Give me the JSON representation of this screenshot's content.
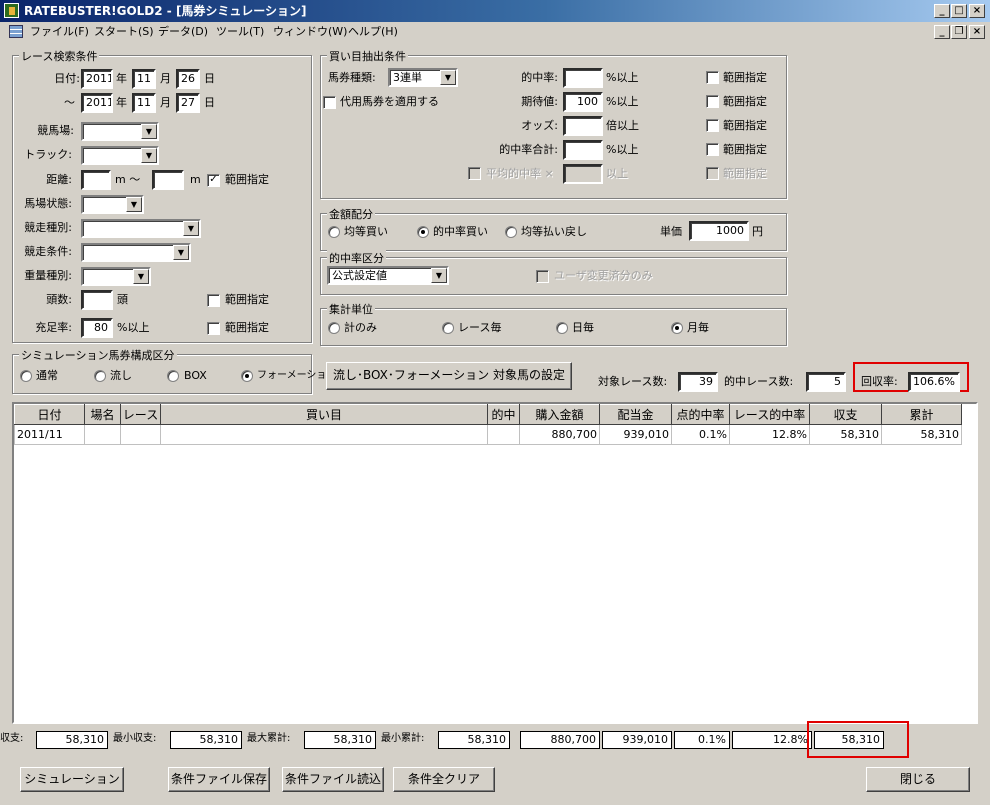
{
  "window": {
    "title": "RATEBUSTER!GOLD2 - [馬券シミュレーション]"
  },
  "menu": [
    "ファイル(F)",
    "スタート(S)",
    "データ(D)",
    "ツール(T)",
    "ウィンドウ(W)",
    "ヘルプ(H)"
  ],
  "race": {
    "caption": "レース検索条件",
    "date_label": "日付:",
    "tilde": "～",
    "from": {
      "year": "2011",
      "month": "11",
      "day": "26"
    },
    "to": {
      "year": "2011",
      "month": "11",
      "day": "27"
    },
    "year_unit": "年",
    "month_unit": "月",
    "day_unit": "日",
    "course_label": "競馬場:",
    "track_label": "トラック:",
    "distance_label": "距離:",
    "m_unit": "m",
    "m_tilde": "m ～",
    "range_label": "範囲指定",
    "condition_label": "馬場状態:",
    "type_label": "競走種別:",
    "cond_label": "競走条件:",
    "weight_label": "重量種別:",
    "heads_label": "頭数:",
    "heads_unit": "頭",
    "fill_label": "充足率:",
    "fill_value": "80",
    "fill_unit": "%以上"
  },
  "buy": {
    "caption": "買い目抽出条件",
    "ticket_label": "馬券種類:",
    "ticket_value": "3連単",
    "substitute_label": "代用馬券を適用する",
    "hit_label": "的中率:",
    "hit_unit": "%以上",
    "exp_label": "期待値:",
    "exp_value": "100",
    "exp_unit": "%以上",
    "odds_label": "オッズ:",
    "odds_unit": "倍以上",
    "sum_label": "的中率合計:",
    "sum_unit": "%以上",
    "avg_label": "平均的中率 ×",
    "avg_unit": "以上",
    "range_label": "範囲指定"
  },
  "alloc": {
    "caption": "金額配分",
    "opt1": "均等買い",
    "opt2": "的中率買い",
    "opt3": "均等払い戻し",
    "unit_label": "単価",
    "unit_value": "1000",
    "yen": "円"
  },
  "hitcat": {
    "caption": "的中率区分",
    "value": "公式設定値",
    "user_label": "ユーザ変更済分のみ"
  },
  "agg": {
    "caption": "集計単位",
    "opt1": "計のみ",
    "opt2": "レース毎",
    "opt3": "日毎",
    "opt4": "月毎"
  },
  "sim": {
    "caption": "シミュレーション馬券構成区分",
    "opt1": "通常",
    "opt2": "流し",
    "opt3": "BOX",
    "opt4": "フォーメーション"
  },
  "setup_button": "流し･BOX･フォーメーション 対象馬の設定",
  "stats": {
    "races_label": "対象レース数:",
    "races": "39",
    "hits_label": "的中レース数:",
    "hits": "5",
    "rate_label": "回収率:",
    "rate": "106.6%"
  },
  "table": {
    "headers": [
      "日付",
      "場名",
      "レース",
      "買い目",
      "的中",
      "購入金額",
      "配当金",
      "点的中率",
      "レース的中率",
      "収支",
      "累計"
    ],
    "rows": [
      [
        "2011/11",
        "",
        "",
        "",
        "",
        "880,700",
        "939,010",
        "0.1%",
        "12.8%",
        "58,310",
        "58,310"
      ]
    ]
  },
  "footer": {
    "balance_label": "収支:",
    "balance": "58,310",
    "min_bal_label": "最小収支:",
    "min_bal": "58,310",
    "max_cum_label": "最大累計:",
    "max_cum": "58,310",
    "min_cum_label": "最小累計:",
    "min_cum": "58,310",
    "purchase": "880,700",
    "payout": "939,010",
    "point_rate": "0.1%",
    "race_rate": "12.8%",
    "total": "58,310"
  },
  "buttons": {
    "simulate": "シミュレーション",
    "save": "条件ファイル保存",
    "load": "条件ファイル読込",
    "clear": "条件全クリア",
    "close": "閉じる"
  }
}
